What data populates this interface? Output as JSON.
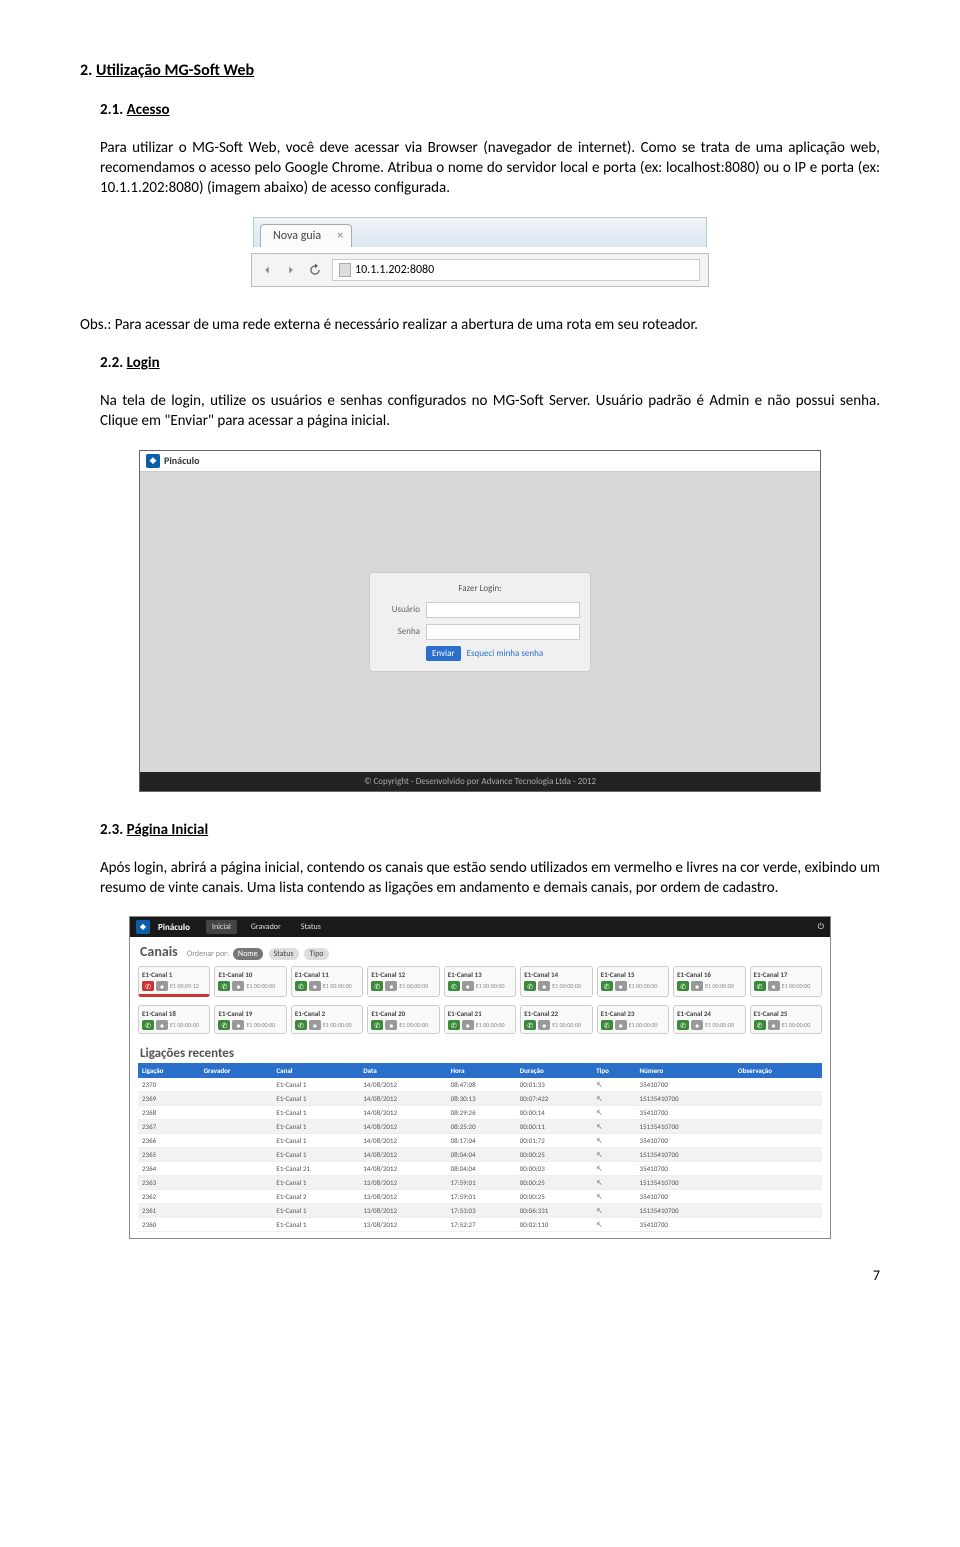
{
  "doc": {
    "sec2_num": "2.",
    "sec2_title": "Utilização MG-Soft Web",
    "sec21_num": "2.1.",
    "sec21_title": "Acesso",
    "p1": "Para utilizar o MG-Soft Web, você deve acessar via Browser (navegador de internet). Como se trata de uma aplicação web, recomendamos o acesso pelo Google Chrome. Atribua o nome do servidor local e porta (ex: localhost:8080) ou o IP e porta (ex: 10.1.1.202:8080) (imagem abaixo) de acesso configurada.",
    "obs": "Obs.: Para acessar de uma rede externa é necessário realizar a abertura de uma rota em seu roteador.",
    "sec22_num": "2.2.",
    "sec22_title": "Login",
    "p2": "Na tela de login, utilize os usuários e senhas configurados no MG-Soft Server. Usuário padrão é Admin e não possui senha. Clique em \"Enviar\" para acessar a página inicial.",
    "sec23_num": "2.3.",
    "sec23_title": "Página Inicial",
    "p3": "Após login, abrirá a página inicial, contendo os canais que estão sendo utilizados em vermelho e livres na cor verde, exibindo um resumo de vinte canais. Uma lista contendo as ligações em andamento e demais canais, por ordem de cadastro.",
    "page_number": "7"
  },
  "browser": {
    "tab_label": "Nova guia",
    "address": "10.1.1.202:8080"
  },
  "login": {
    "brand": "Pináculo",
    "title": "Fazer Login:",
    "user_label": "Usuário",
    "pass_label": "Senha",
    "submit": "Enviar",
    "forgot": "Esqueci minha senha",
    "footer": "© Copyright - Desenvolvido por Advance Tecnologia Ltda - 2012"
  },
  "canais": {
    "brand": "Pináculo",
    "tabs": [
      "Inicial",
      "Gravador",
      "Status"
    ],
    "section_title": "Canais",
    "sort_label": "Ordenar por:",
    "sort_options": [
      "Nome",
      "Status",
      "Tipo"
    ],
    "row1": [
      {
        "name": "E1-Canal 1",
        "sub": "00:09:12",
        "active": true,
        "color": "red"
      },
      {
        "name": "E1-Canal 10",
        "sub": "00:00:00",
        "color": "green"
      },
      {
        "name": "E1-Canal 11",
        "sub": "00:00:00",
        "color": "green"
      },
      {
        "name": "E1-Canal 12",
        "sub": "00:00:00",
        "color": "green"
      },
      {
        "name": "E1-Canal 13",
        "sub": "00:00:00",
        "color": "green"
      },
      {
        "name": "E1-Canal 14",
        "sub": "00:00:00",
        "color": "green"
      },
      {
        "name": "E1-Canal 15",
        "sub": "00:00:00",
        "color": "green"
      },
      {
        "name": "E1-Canal 16",
        "sub": "00:00:00",
        "color": "green"
      },
      {
        "name": "E1-Canal 17",
        "sub": "00:00:00",
        "color": "green"
      }
    ],
    "row2": [
      {
        "name": "E1-Canal 18",
        "sub": "00:00:00",
        "color": "green"
      },
      {
        "name": "E1-Canal 19",
        "sub": "00:00:00",
        "color": "green"
      },
      {
        "name": "E1-Canal 2",
        "sub": "00:00:00",
        "color": "green"
      },
      {
        "name": "E1-Canal 20",
        "sub": "00:00:00",
        "color": "green"
      },
      {
        "name": "E1-Canal 21",
        "sub": "00:00:00",
        "color": "green"
      },
      {
        "name": "E1-Canal 22",
        "sub": "00:00:00",
        "color": "green"
      },
      {
        "name": "E1-Canal 23",
        "sub": "00:00:00",
        "color": "green"
      },
      {
        "name": "E1-Canal 24",
        "sub": "00:00:00",
        "color": "green"
      },
      {
        "name": "E1-Canal 25",
        "sub": "00:00:00",
        "color": "green"
      }
    ],
    "calls_title": "Ligações recentes",
    "calls_headers": [
      "Ligação",
      "Gravador",
      "Canal",
      "Data",
      "Hora",
      "Duração",
      "Tipo",
      "Número",
      "Observação"
    ],
    "calls": [
      {
        "lig": "2370",
        "grav": "",
        "canal": "E1-Canal 1",
        "data": "14/08/2012",
        "hora": "08:47:08",
        "dur": "00:01:33",
        "tipo": "↖",
        "num": "35410700",
        "obs": ""
      },
      {
        "lig": "2369",
        "grav": "",
        "canal": "E1-Canal 1",
        "data": "14/08/2012",
        "hora": "08:30:13",
        "dur": "00:07:422",
        "tipo": "↖",
        "num": "15135410700",
        "obs": ""
      },
      {
        "lig": "2368",
        "grav": "",
        "canal": "E1-Canal 1",
        "data": "14/08/2012",
        "hora": "08:29:26",
        "dur": "00:00:14",
        "tipo": "↖",
        "num": "35410700",
        "obs": ""
      },
      {
        "lig": "2367",
        "grav": "",
        "canal": "E1-Canal 1",
        "data": "14/08/2012",
        "hora": "08:25:20",
        "dur": "00:00:11",
        "tipo": "↖",
        "num": "15135410700",
        "obs": ""
      },
      {
        "lig": "2366",
        "grav": "",
        "canal": "E1-Canal 1",
        "data": "14/08/2012",
        "hora": "08:17:04",
        "dur": "00:01:72",
        "tipo": "↖",
        "num": "35410700",
        "obs": ""
      },
      {
        "lig": "2365",
        "grav": "",
        "canal": "E1-Canal 1",
        "data": "14/08/2012",
        "hora": "08:04:04",
        "dur": "00:00:25",
        "tipo": "↖",
        "num": "15135410700",
        "obs": ""
      },
      {
        "lig": "2364",
        "grav": "",
        "canal": "E1-Canal 21",
        "data": "14/08/2012",
        "hora": "08:04:04",
        "dur": "00:00:03",
        "tipo": "↖",
        "num": "35410700",
        "obs": ""
      },
      {
        "lig": "2363",
        "grav": "",
        "canal": "E1-Canal 1",
        "data": "13/08/2012",
        "hora": "17:59:01",
        "dur": "00:00:25",
        "tipo": "↖",
        "num": "15135410700",
        "obs": ""
      },
      {
        "lig": "2362",
        "grav": "",
        "canal": "E1-Canal 2",
        "data": "13/08/2012",
        "hora": "17:59:01",
        "dur": "00:00:25",
        "tipo": "↖",
        "num": "35410700",
        "obs": ""
      },
      {
        "lig": "2361",
        "grav": "",
        "canal": "E1-Canal 1",
        "data": "13/08/2012",
        "hora": "17:53:03",
        "dur": "00:06:331",
        "tipo": "↖",
        "num": "15135410700",
        "obs": ""
      },
      {
        "lig": "2360",
        "grav": "",
        "canal": "E1-Canal 1",
        "data": "13/08/2012",
        "hora": "17:52:27",
        "dur": "00:02:110",
        "tipo": "↖",
        "num": "35410700",
        "obs": ""
      }
    ]
  }
}
